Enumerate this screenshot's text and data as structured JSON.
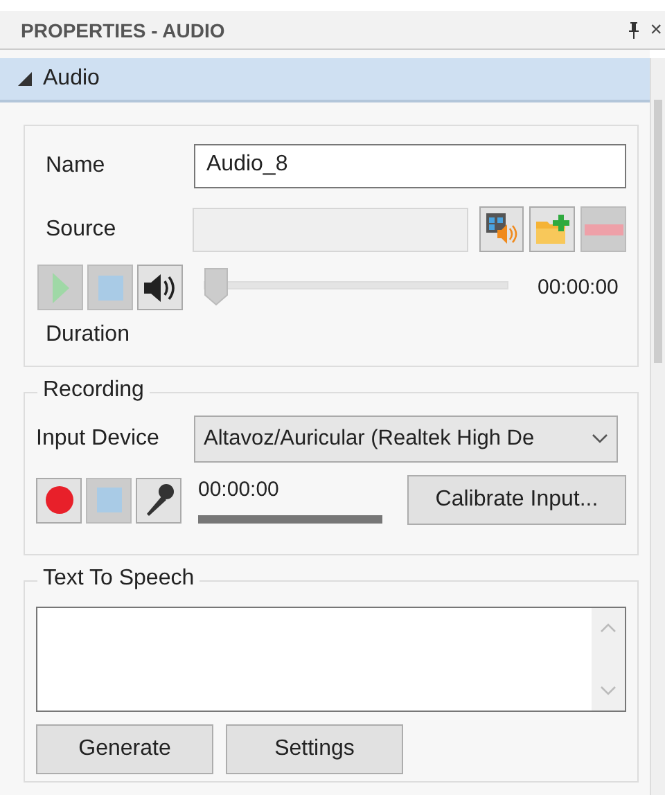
{
  "panel": {
    "title": "PROPERTIES - AUDIO",
    "close": "×"
  },
  "section": {
    "label": "Audio",
    "expanded": true
  },
  "audio": {
    "name_label": "Name",
    "name_value": "Audio_8",
    "source_label": "Source",
    "source_disabled": true,
    "source_buttons": [
      {
        "kind": "video-audio",
        "disabled": false
      },
      {
        "kind": "folder-add",
        "disabled": false
      },
      {
        "kind": "remove",
        "disabled": true
      }
    ],
    "playback_buttons": [
      {
        "kind": "play",
        "disabled": true
      },
      {
        "kind": "stop",
        "disabled": true
      },
      {
        "kind": "volume",
        "disabled": false
      }
    ],
    "position": {
      "level": 0
    },
    "time": "00:00:00",
    "duration_label": "Duration"
  },
  "recording": {
    "legend": "Recording",
    "device_label": "Input Device",
    "device_value": "Altavoz/Auricular (Realtek High De",
    "buttons": [
      {
        "kind": "record",
        "disabled": false
      },
      {
        "kind": "stop",
        "disabled": true
      },
      {
        "kind": "microphone",
        "disabled": false
      }
    ],
    "time": "00:00:00",
    "calibrate": "Calibrate Input..."
  },
  "tts": {
    "legend": "Text To Speech",
    "buttons": [
      "Generate",
      "Settings"
    ]
  }
}
